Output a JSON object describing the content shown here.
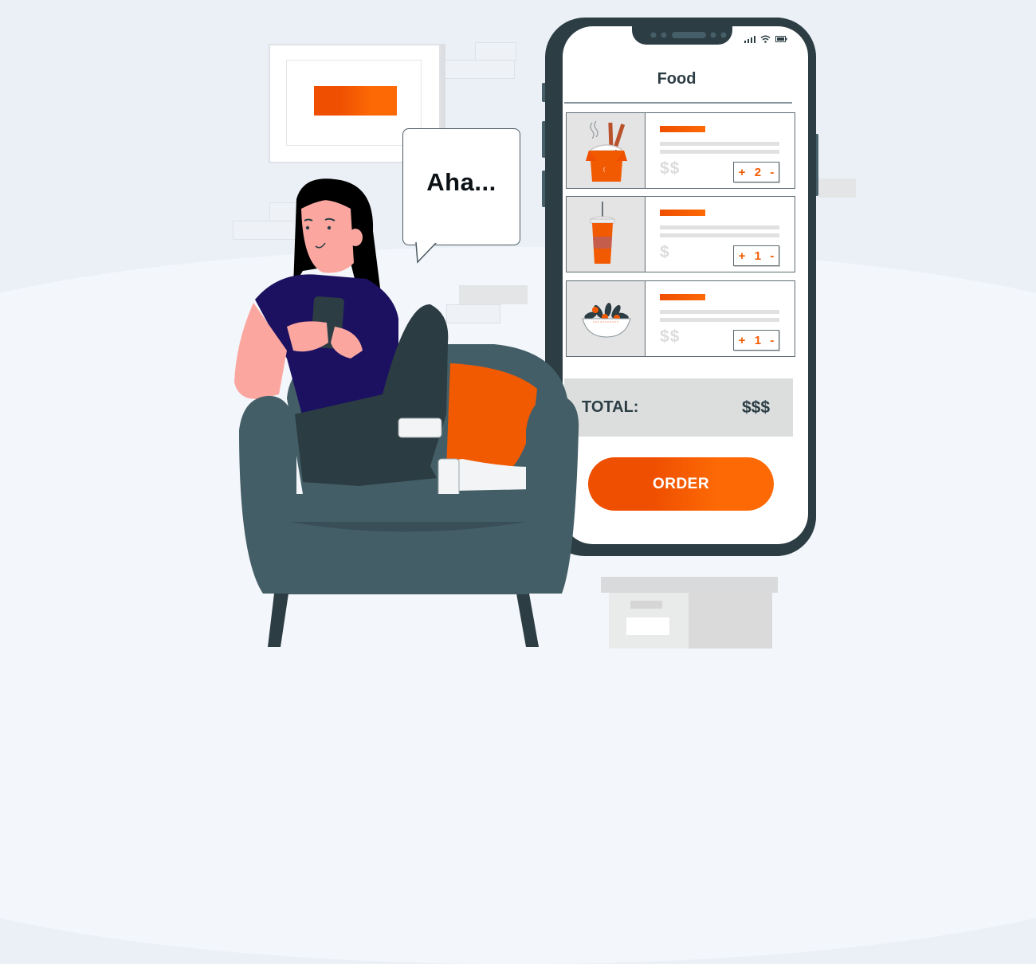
{
  "scene": {
    "description": "Woman in armchair ordering food on smartphone app",
    "speech_bubble": "Aha..."
  },
  "phone": {
    "status_icons": [
      "signal-icon",
      "wifi-icon",
      "battery-icon"
    ],
    "app_title": "Food",
    "items": [
      {
        "icon": "noodle-box-icon",
        "price": "$$",
        "quantity": "2",
        "plus": "+",
        "minus": "-"
      },
      {
        "icon": "drink-cup-icon",
        "price": "$",
        "quantity": "1",
        "plus": "+",
        "minus": "-"
      },
      {
        "icon": "salad-bowl-icon",
        "price": "$$",
        "quantity": "1",
        "plus": "+",
        "minus": "-"
      }
    ],
    "total_label": "TOTAL:",
    "total_value": "$$$",
    "order_button": "ORDER"
  },
  "colors": {
    "accent": "#f25a02",
    "accent_start": "#ef4f00",
    "accent_end": "#fd6a05",
    "phone_frame": "#2c3d44",
    "chair": "#445e67",
    "shirt": "#1b1160",
    "background": "#ebf0f7"
  }
}
